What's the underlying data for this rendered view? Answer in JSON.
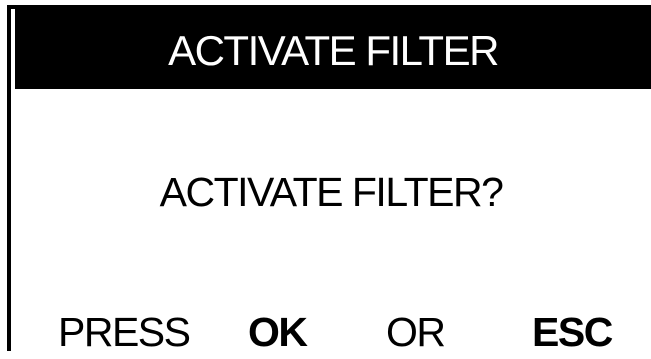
{
  "dialog": {
    "title": "ACTIVATE FILTER",
    "question": "ACTIVATE FILTER?",
    "prompt": {
      "press": "PRESS",
      "ok": "OK",
      "or": "OR",
      "esc": "ESC"
    }
  },
  "colors": {
    "title_background": "#000000",
    "title_text": "#ffffff",
    "body_background": "#ffffff",
    "body_text": "#000000"
  }
}
